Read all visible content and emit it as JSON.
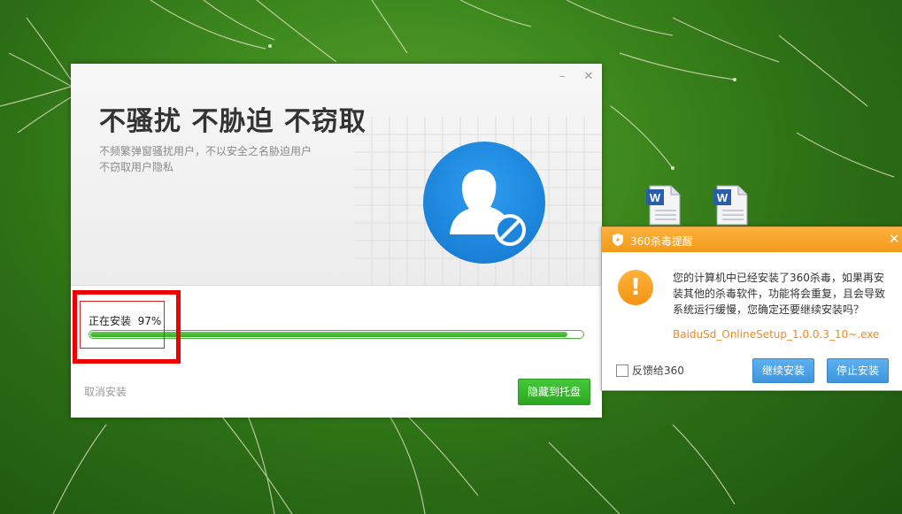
{
  "installer": {
    "headline": "不骚扰 不胁迫 不窃取",
    "subtitle_line1": "不频繁弹窗骚扰用户，不以安全之名胁迫用户",
    "subtitle_line2": "不窃取用户隐私",
    "progress_label": "正在安装",
    "progress_percent_text": "97%",
    "progress_fraction": 0.97,
    "cancel_label": "取消安装",
    "hide_button_label": "隐藏到托盘",
    "minimize_glyph": "–",
    "close_glyph": "✕"
  },
  "alert": {
    "title": "360杀毒提醒",
    "close_glyph": "✕",
    "warning_glyph": "!",
    "message_line1": "您的计算机中已经安装了360杀毒，如果再安",
    "message_line2": "装其他的杀毒软件，功能将会重复，且会导致",
    "message_line3": "系统运行缓慢，您确定还要继续安装吗？",
    "filename": "BaiduSd_OnlineSetup_1.0.0.3_10~.exe",
    "feedback_label": "反馈给360",
    "continue_label": "继续安装",
    "stop_label": "停止安装"
  },
  "icons": {
    "desktop_file": "word-document-icon",
    "shield": "user-block-shield-icon",
    "alert_logo": "360-shield-logo-icon",
    "warning": "warning-icon"
  },
  "colors": {
    "progress_green": "#3aab2a",
    "hide_button_green": "#2ea723",
    "alert_orange": "#f39a1c",
    "alert_button_blue": "#3f95dd",
    "highlight_red": "#ee0000",
    "shield_blue": "#1d86dc"
  }
}
